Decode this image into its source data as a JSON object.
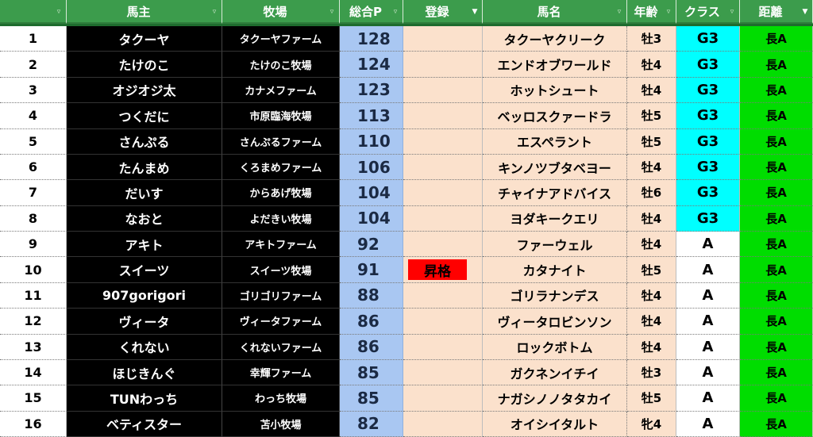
{
  "headers": {
    "rank": "",
    "owner": "馬主",
    "farm": "牧場",
    "points": "総合P",
    "registration": "登録",
    "horse": "馬名",
    "age": "年齢",
    "class": "クラス",
    "distance": "距離"
  },
  "colors": {
    "header_bg": "#3c9c4c",
    "owner_bg": "#000000",
    "points_bg": "#a9c7f2",
    "peach_bg": "#fbe1cc",
    "g3_bg": "#00ffff",
    "distance_bg": "#00dd00",
    "promotion_bg": "#ff0000"
  },
  "rows": [
    {
      "rank": "1",
      "owner": "タクーヤ",
      "farm": "タクーヤファーム",
      "points": "128",
      "registration": "",
      "horse": "タクーヤクリーク",
      "age": "牡3",
      "class": "G3",
      "distance": "長A"
    },
    {
      "rank": "2",
      "owner": "たけのこ",
      "farm": "たけのこ牧場",
      "points": "124",
      "registration": "",
      "horse": "エンドオブワールド",
      "age": "牡4",
      "class": "G3",
      "distance": "長A"
    },
    {
      "rank": "3",
      "owner": "オジオジ太",
      "farm": "カナメファーム",
      "points": "123",
      "registration": "",
      "horse": "ホットシュート",
      "age": "牡4",
      "class": "G3",
      "distance": "長A"
    },
    {
      "rank": "4",
      "owner": "つくだに",
      "farm": "市原臨海牧場",
      "points": "113",
      "registration": "",
      "horse": "ベッロスクァードラ",
      "age": "牡5",
      "class": "G3",
      "distance": "長A"
    },
    {
      "rank": "5",
      "owner": "さんぷる",
      "farm": "さんぷるファーム",
      "points": "110",
      "registration": "",
      "horse": "エスペラント",
      "age": "牡5",
      "class": "G3",
      "distance": "長A"
    },
    {
      "rank": "6",
      "owner": "たんまめ",
      "farm": "くろまめファーム",
      "points": "106",
      "registration": "",
      "horse": "キンノツブタベヨー",
      "age": "牡4",
      "class": "G3",
      "distance": "長A"
    },
    {
      "rank": "7",
      "owner": "だいす",
      "farm": "からあげ牧場",
      "points": "104",
      "registration": "",
      "horse": "チャイナアドバイス",
      "age": "牡6",
      "class": "G3",
      "distance": "長A"
    },
    {
      "rank": "8",
      "owner": "なおと",
      "farm": "よだきい牧場",
      "points": "104",
      "registration": "",
      "horse": "ヨダキークエリ",
      "age": "牡4",
      "class": "G3",
      "distance": "長A"
    },
    {
      "rank": "9",
      "owner": "アキト",
      "farm": "アキトファーム",
      "points": "92",
      "registration": "",
      "horse": "ファーウェル",
      "age": "牡4",
      "class": "A",
      "distance": "長A"
    },
    {
      "rank": "10",
      "owner": "スイーツ",
      "farm": "スイーツ牧場",
      "points": "91",
      "registration": "昇格",
      "horse": "カタナイト",
      "age": "牡5",
      "class": "A",
      "distance": "長A"
    },
    {
      "rank": "11",
      "owner": "907gorigori",
      "farm": "ゴリゴリファーム",
      "points": "88",
      "registration": "",
      "horse": "ゴリラナンデス",
      "age": "牡4",
      "class": "A",
      "distance": "長A"
    },
    {
      "rank": "12",
      "owner": "ヴィータ",
      "farm": "ヴィータファーム",
      "points": "86",
      "registration": "",
      "horse": "ヴィータロビンソン",
      "age": "牡4",
      "class": "A",
      "distance": "長A"
    },
    {
      "rank": "13",
      "owner": "くれない",
      "farm": "くれないファーム",
      "points": "86",
      "registration": "",
      "horse": "ロックボトム",
      "age": "牡4",
      "class": "A",
      "distance": "長A"
    },
    {
      "rank": "14",
      "owner": "ほじきんぐ",
      "farm": "幸輝ファーム",
      "points": "85",
      "registration": "",
      "horse": "ガクネンイチイ",
      "age": "牡3",
      "class": "A",
      "distance": "長A"
    },
    {
      "rank": "15",
      "owner": "TUNわっち",
      "farm": "わっち牧場",
      "points": "85",
      "registration": "",
      "horse": "ナガシノノタタカイ",
      "age": "牡5",
      "class": "A",
      "distance": "長A"
    },
    {
      "rank": "16",
      "owner": "ベティスター",
      "farm": "苫小牧場",
      "points": "82",
      "registration": "",
      "horse": "オイシイタルト",
      "age": "牝4",
      "class": "A",
      "distance": "長A"
    }
  ]
}
